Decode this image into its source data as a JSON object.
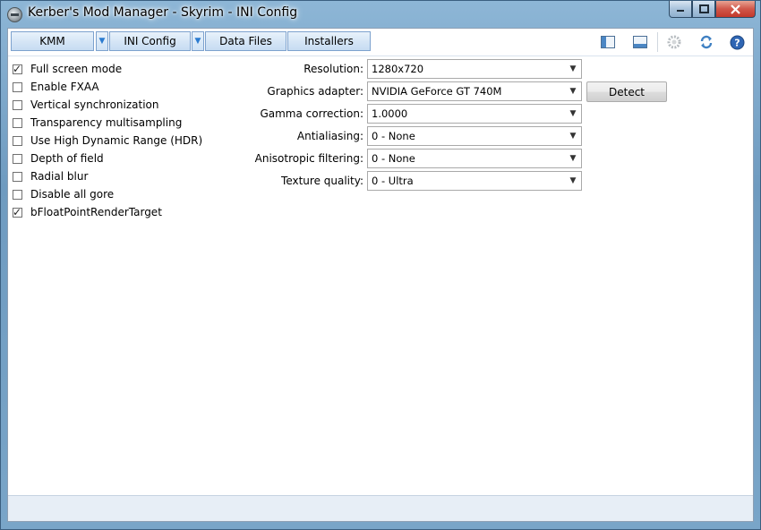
{
  "window": {
    "title": "Kerber's Mod Manager - Skyrim - INI Config"
  },
  "toolbar": {
    "kmm": "KMM",
    "ini_config": "INI Config",
    "data_files": "Data Files",
    "installers": "Installers"
  },
  "checkboxes": [
    {
      "label": "Full screen mode",
      "checked": true
    },
    {
      "label": "Enable FXAA",
      "checked": false
    },
    {
      "label": "Vertical synchronization",
      "checked": false
    },
    {
      "label": "Transparency multisampling",
      "checked": false
    },
    {
      "label": "Use High Dynamic Range (HDR)",
      "checked": false
    },
    {
      "label": "Depth of field",
      "checked": false
    },
    {
      "label": "Radial blur",
      "checked": false
    },
    {
      "label": "Disable all gore",
      "checked": false
    },
    {
      "label": "bFloatPointRenderTarget",
      "checked": true
    }
  ],
  "settings": [
    {
      "label": "Resolution:",
      "value": "1280x720"
    },
    {
      "label": "Graphics adapter:",
      "value": "NVIDIA GeForce GT 740M"
    },
    {
      "label": "Gamma correction:",
      "value": "1.0000"
    },
    {
      "label": "Antialiasing:",
      "value": "0 - None"
    },
    {
      "label": "Anisotropic filtering:",
      "value": "0 - None"
    },
    {
      "label": "Texture quality:",
      "value": "0 - Ultra"
    }
  ],
  "detect_button": "Detect",
  "icons": {
    "app": "kmm-logo-icon",
    "left_panel": "left-panel-icon",
    "bottom_panel": "bottom-panel-icon",
    "settings": "gear-icon",
    "refresh": "refresh-icon",
    "help": "help-icon"
  },
  "colors": {
    "accent": "#2b7bd0",
    "title_bar": "#7fa9cc"
  }
}
